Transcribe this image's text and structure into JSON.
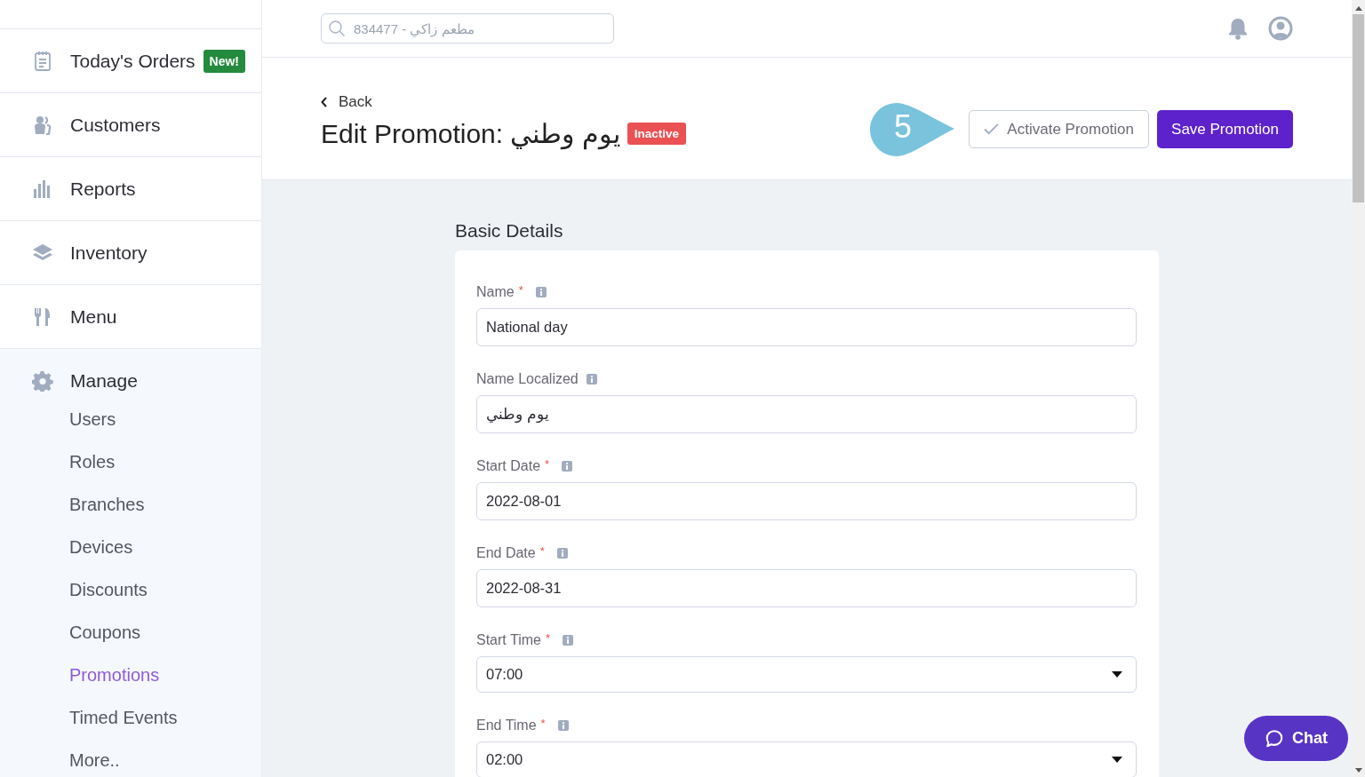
{
  "sidebar": {
    "items": [
      {
        "label": "Today's Orders",
        "badge": "New!",
        "selected": false
      },
      {
        "label": "Customers",
        "selected": false
      },
      {
        "label": "Reports",
        "selected": false
      },
      {
        "label": "Inventory",
        "selected": false
      },
      {
        "label": "Menu",
        "selected": false
      }
    ],
    "section": {
      "label": "Manage",
      "children": [
        {
          "label": "Users",
          "selected": false
        },
        {
          "label": "Roles",
          "selected": false
        },
        {
          "label": "Branches",
          "selected": false
        },
        {
          "label": "Devices",
          "selected": false
        },
        {
          "label": "Discounts",
          "selected": false
        },
        {
          "label": "Coupons",
          "selected": false
        },
        {
          "label": "Promotions",
          "selected": true
        },
        {
          "label": "Timed Events",
          "selected": false
        },
        {
          "label": "More..",
          "selected": false
        }
      ]
    }
  },
  "topbar": {
    "search": {
      "placeholder": "مطعم زاكي - 834477"
    }
  },
  "page": {
    "back": "Back",
    "title": "Edit Promotion: يوم وطني",
    "status": "Inactive",
    "callout": "5",
    "buttons": [
      {
        "label": "Activate Promotion",
        "kind": "outline"
      },
      {
        "label": "Save Promotion",
        "kind": "primary"
      }
    ]
  },
  "form": {
    "heading": "Basic Details",
    "fields": [
      {
        "label": "Name",
        "required": true,
        "kind": "text",
        "value": "National day"
      },
      {
        "label": "Name Localized",
        "required": false,
        "kind": "text",
        "value": "يوم وطني"
      },
      {
        "label": "Start Date",
        "required": true,
        "kind": "text",
        "value": "2022-08-01"
      },
      {
        "label": "End Date",
        "required": true,
        "kind": "text",
        "value": "2022-08-31"
      },
      {
        "label": "Start Time",
        "required": true,
        "kind": "select",
        "value": "07:00"
      },
      {
        "label": "End Time",
        "required": true,
        "kind": "select",
        "value": "02:00"
      }
    ],
    "required_mark": "*"
  },
  "chat": {
    "label": "Chat"
  }
}
